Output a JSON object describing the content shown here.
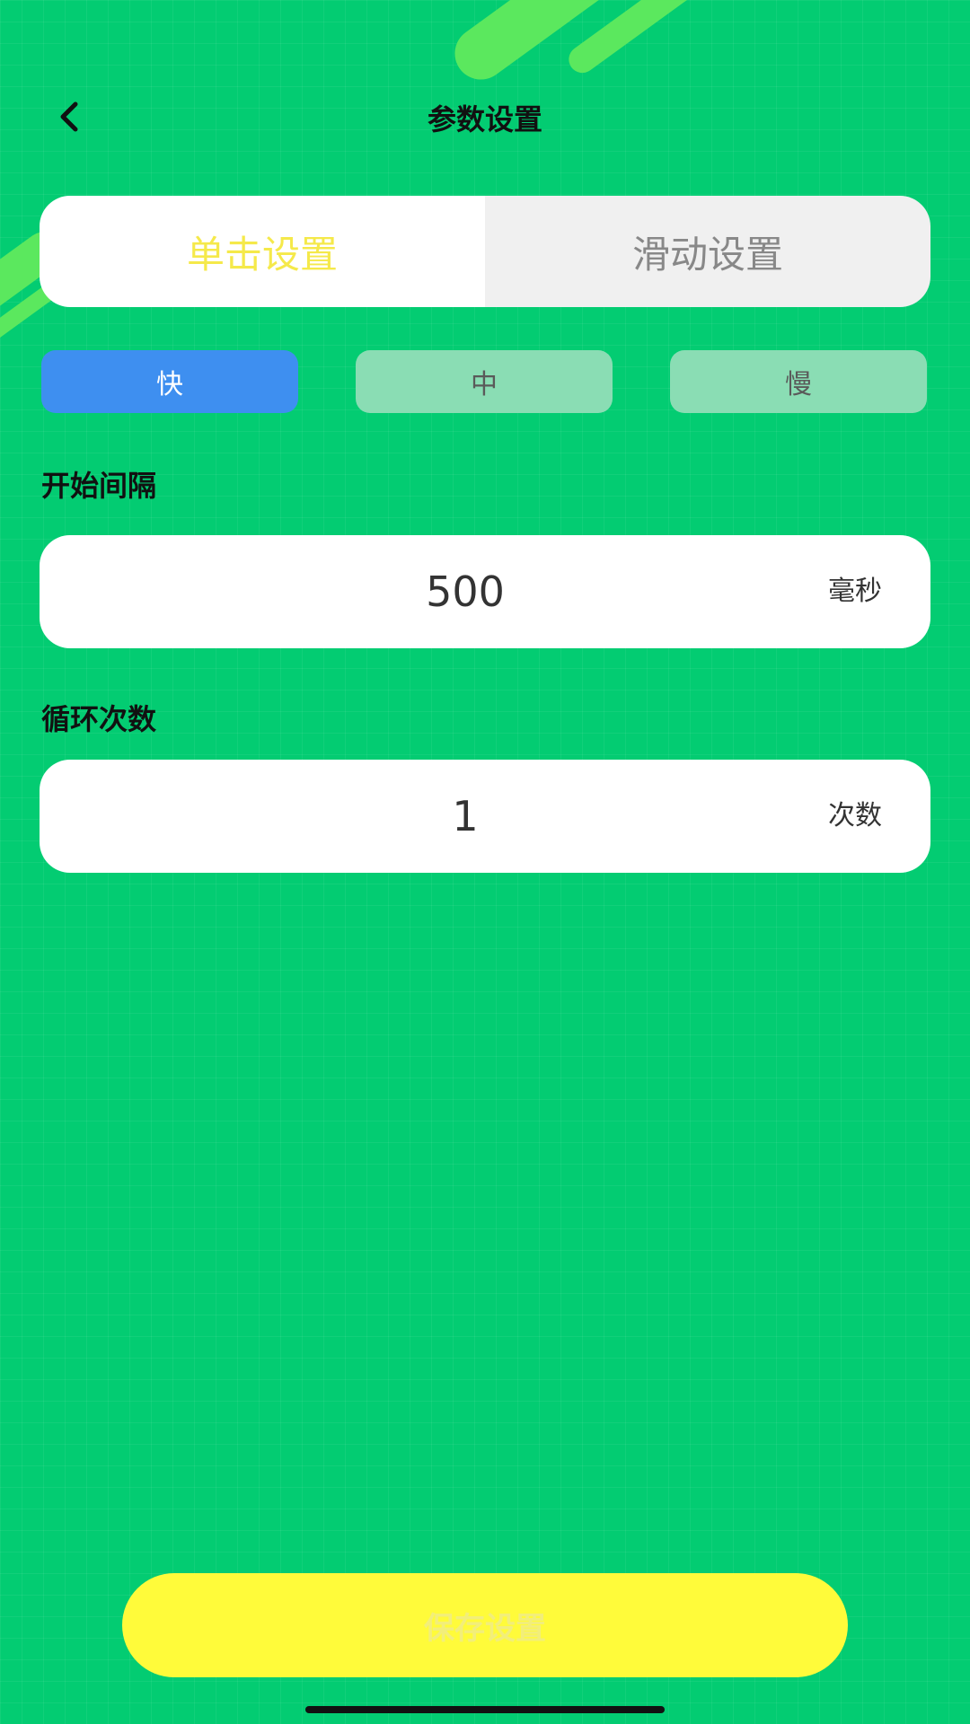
{
  "header": {
    "title": "参数设置"
  },
  "tabs": [
    {
      "label": "单击设置",
      "active": true
    },
    {
      "label": "滑动设置",
      "active": false
    }
  ],
  "speed_options": [
    {
      "label": "快",
      "selected": true
    },
    {
      "label": "中",
      "selected": false
    },
    {
      "label": "慢",
      "selected": false
    }
  ],
  "fields": {
    "start_interval": {
      "label": "开始间隔",
      "value": "500",
      "unit": "毫秒"
    },
    "loop_count": {
      "label": "循环次数",
      "value": "1",
      "unit": "次数"
    }
  },
  "save_button": {
    "label": "保存设置"
  },
  "icons": {
    "back": "chevron-left-icon"
  },
  "colors": {
    "background": "#03CC72",
    "accent_blue": "#3E8FF0",
    "save_yellow": "#FFFB3A",
    "active_tab_text": "#F5E94A"
  }
}
